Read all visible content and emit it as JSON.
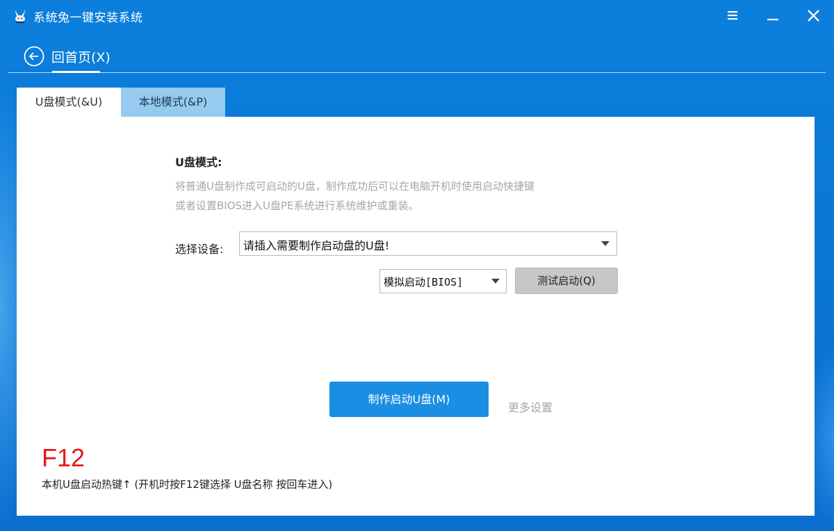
{
  "window": {
    "title": "系统兔一键安装系统",
    "icons": {
      "logo": "rabbit-logo-icon",
      "menu": "menu-icon",
      "minimize": "minimize-icon",
      "close": "close-icon"
    }
  },
  "nav": {
    "back_label": "回首页(X)",
    "back_icon": "back-arrow-icon"
  },
  "tabs": [
    {
      "label": "U盘模式(&U)",
      "active": true
    },
    {
      "label": "本地模式(&P)",
      "active": false
    }
  ],
  "main": {
    "title": "U盘模式:",
    "description_line1": "将普通U盘制作成可启动的U盘，制作成功后可以在电脑开机时使用启动快捷键",
    "description_line2": "或者设置BIOS进入U盘PE系统进行系统维护或重装。",
    "device_label": "选择设备:",
    "device_value": "请插入需要制作启动盘的U盘!",
    "boot_mode_value": "模拟启动[BIOS]",
    "test_button": "测试启动(Q)",
    "make_button": "制作启动U盘(M)",
    "more_settings": "更多设置",
    "hotkey": "F12",
    "hotkey_note": "本机U盘启动热键↑ (开机时按F12键选择 U盘名称 按回车进入)"
  },
  "colors": {
    "background": "#0c7fdc",
    "active_tab": "#ffffff",
    "inactive_tab": "#96cbef",
    "primary_button": "#1a8ee3",
    "secondary_button": "#c7c7c7",
    "hotkey": "#e81818",
    "muted_text": "#a6a6a6"
  }
}
